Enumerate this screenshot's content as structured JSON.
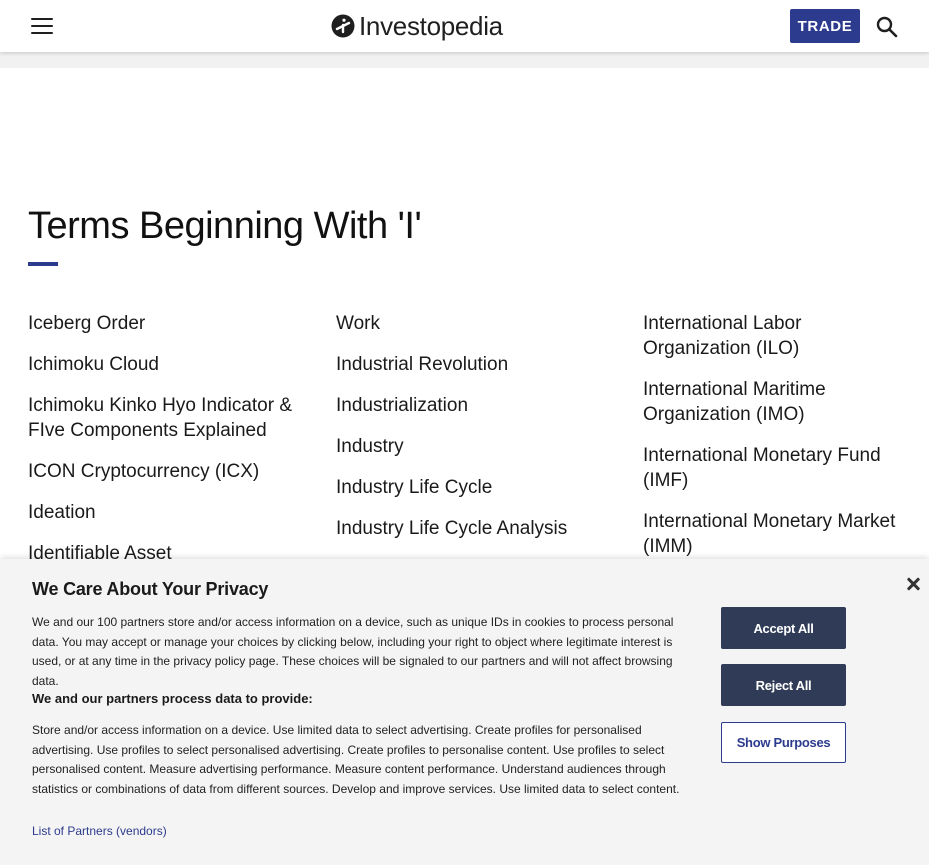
{
  "header": {
    "logo_text": "Investopedia",
    "trade_label": "TRADE",
    "brand_color": "#2c3b8d"
  },
  "main": {
    "title": "Terms Beginning With 'I'",
    "columns": [
      [
        "Iceberg Order",
        "Ichimoku Cloud",
        "Ichimoku Kinko Hyo Indicator & FIve Components Explained",
        "ICON Cryptocurrency (ICX)",
        "Ideation",
        "Identifiable Asset"
      ],
      [
        "Work",
        "Industrial Revolution",
        "Industrialization",
        "Industry",
        "Industry Life Cycle",
        "Industry Life Cycle Analysis"
      ],
      [
        "International Labor Organization (ILO)",
        "International Maritime Organization (IMO)",
        "International Monetary Fund (IMF)",
        "International Monetary Market (IMM)"
      ]
    ]
  },
  "privacy": {
    "title": "We Care About Your Privacy",
    "body1": "We and our 100 partners store and/or access information on a device, such as unique IDs in cookies to process personal data. You may accept or manage your choices by clicking below, including your right to object where legitimate interest is used, or at any time in the privacy policy page. These choices will be signaled to our partners and will not affect browsing data.",
    "subhead": "We and our partners process data to provide:",
    "body2": "Store and/or access information on a device. Use limited data to select advertising. Create profiles for personalised advertising. Use profiles to select personalised advertising. Create profiles to personalise content. Use profiles to select personalised content. Measure advertising performance. Measure content performance. Understand audiences through statistics or combinations of data from different sources. Develop and improve services. Use limited data to select content.",
    "partners_link": "List of Partners (vendors)",
    "accept_label": "Accept All",
    "reject_label": "Reject All",
    "purposes_label": "Show Purposes"
  }
}
